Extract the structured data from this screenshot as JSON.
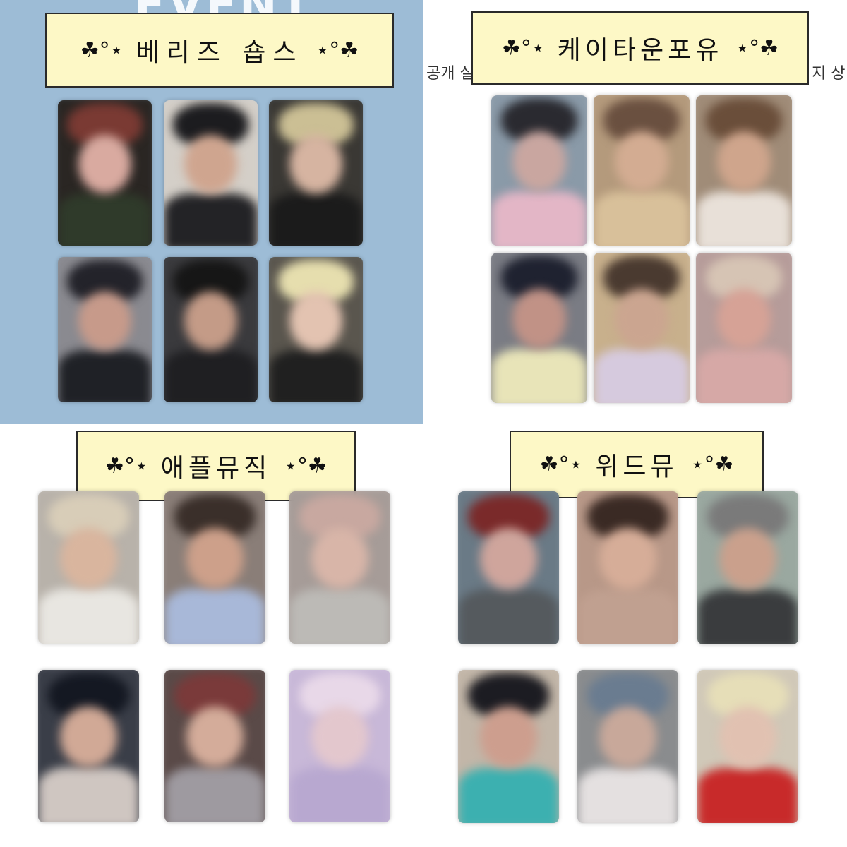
{
  "panels": [
    {
      "id": "tl",
      "title": "베리즈 숍스",
      "deco_left": "☘°⋆",
      "deco_right": "⋆°☘"
    },
    {
      "id": "tr",
      "title": "케이타운포유",
      "deco_left": "☘°⋆",
      "deco_right": "⋆°☘"
    },
    {
      "id": "bl",
      "title": "애플뮤직",
      "deco_left": "☘°⋆",
      "deco_right": "⋆°☘"
    },
    {
      "id": "br",
      "title": "위드뮤",
      "deco_left": "☘°⋆",
      "deco_right": "⋆°☘"
    }
  ],
  "background_text": {
    "top_word": "EVENT",
    "left_fragment": "공개 실",
    "right_fragment": "지 상"
  },
  "colors": {
    "title_box_fill": "#fdf8c6",
    "title_box_border": "#2a2a2a",
    "top_left_panel_bg": "#9dbcd6"
  },
  "photocards": {
    "tl": [
      {
        "bg": "#2a2623",
        "hair": "#7a3a33",
        "face": "#d9aaa0",
        "shirt": "#2f3a2a"
      },
      {
        "bg": "#d4cfc8",
        "hair": "#1c1c1f",
        "face": "#cfa58f",
        "shirt": "#232326"
      },
      {
        "bg": "#3a3834",
        "hair": "#cbbf94",
        "face": "#d6b4a1",
        "shirt": "#1b1b1b"
      },
      {
        "bg": "#8a8a90",
        "hair": "#23232a",
        "face": "#c79a8a",
        "shirt": "#1f2126"
      },
      {
        "bg": "#3a3a3d",
        "hair": "#161616",
        "face": "#c49b87",
        "shirt": "#1f1f22"
      },
      {
        "bg": "#5a564e",
        "hair": "#e6deae",
        "face": "#e3c3b1",
        "shirt": "#202020"
      }
    ],
    "tr": [
      {
        "bg": "#8a9aa8",
        "hair": "#2a2a30",
        "face": "#c9a6a0",
        "shirt": "#e3b6c6"
      },
      {
        "bg": "#b49a7c",
        "hair": "#6a5040",
        "face": "#d3ac92",
        "shirt": "#d8c09a"
      },
      {
        "bg": "#a08c78",
        "hair": "#6a4e3a",
        "face": "#cfa58c",
        "shirt": "#e8e0d8"
      },
      {
        "bg": "#7a7c84",
        "hair": "#1f2230",
        "face": "#c19286",
        "shirt": "#e8e4b8"
      },
      {
        "bg": "#c8b08c",
        "hair": "#4a3a30",
        "face": "#cba590",
        "shirt": "#d6cade"
      },
      {
        "bg": "#b69c9a",
        "hair": "#d6c4b4",
        "face": "#d6a296",
        "shirt": "#d6a8a6"
      }
    ],
    "bl": [
      {
        "bg": "#b8b2aa",
        "hair": "#d8cdb8",
        "face": "#d9b59e",
        "shirt": "#e8e6e1"
      },
      {
        "bg": "#8a7e78",
        "hair": "#3a2f2a",
        "face": "#cda08a",
        "shirt": "#a8b8d8"
      },
      {
        "bg": "#a69c98",
        "hair": "#c8a8a0",
        "face": "#d8b5a8",
        "shirt": "#bcbab6"
      },
      {
        "bg": "#3a3e48",
        "hair": "#141822",
        "face": "#d1a996",
        "shirt": "#cfc6c1"
      },
      {
        "bg": "#5a4a48",
        "hair": "#7a3a3a",
        "face": "#d4ac9a",
        "shirt": "#9e9aa0"
      },
      {
        "bg": "#c8b8d8",
        "hair": "#e8d8e8",
        "face": "#e3c7cd",
        "shirt": "#b8a8d0"
      }
    ],
    "br": [
      {
        "bg": "#6a7a86",
        "hair": "#7a2a2a",
        "face": "#cfa59c",
        "shirt": "#555a5e"
      },
      {
        "bg": "#b89888",
        "hair": "#3a2a24",
        "face": "#d6ad98",
        "shirt": "#c0a090"
      },
      {
        "bg": "#9aa8a0",
        "hair": "#7a7a7a",
        "face": "#caa08c",
        "shirt": "#3a3c3e"
      },
      {
        "bg": "#c2b6a8",
        "hair": "#1c1c22",
        "face": "#cd9e8e",
        "shirt": "#3cb0b0"
      },
      {
        "bg": "#8a8c8e",
        "hair": "#6a7c90",
        "face": "#c8a89a",
        "shirt": "#e4e0e0"
      },
      {
        "bg": "#d0c8b8",
        "hair": "#e6deb8",
        "face": "#e1c1b1",
        "shirt": "#c82a2a"
      }
    ]
  }
}
